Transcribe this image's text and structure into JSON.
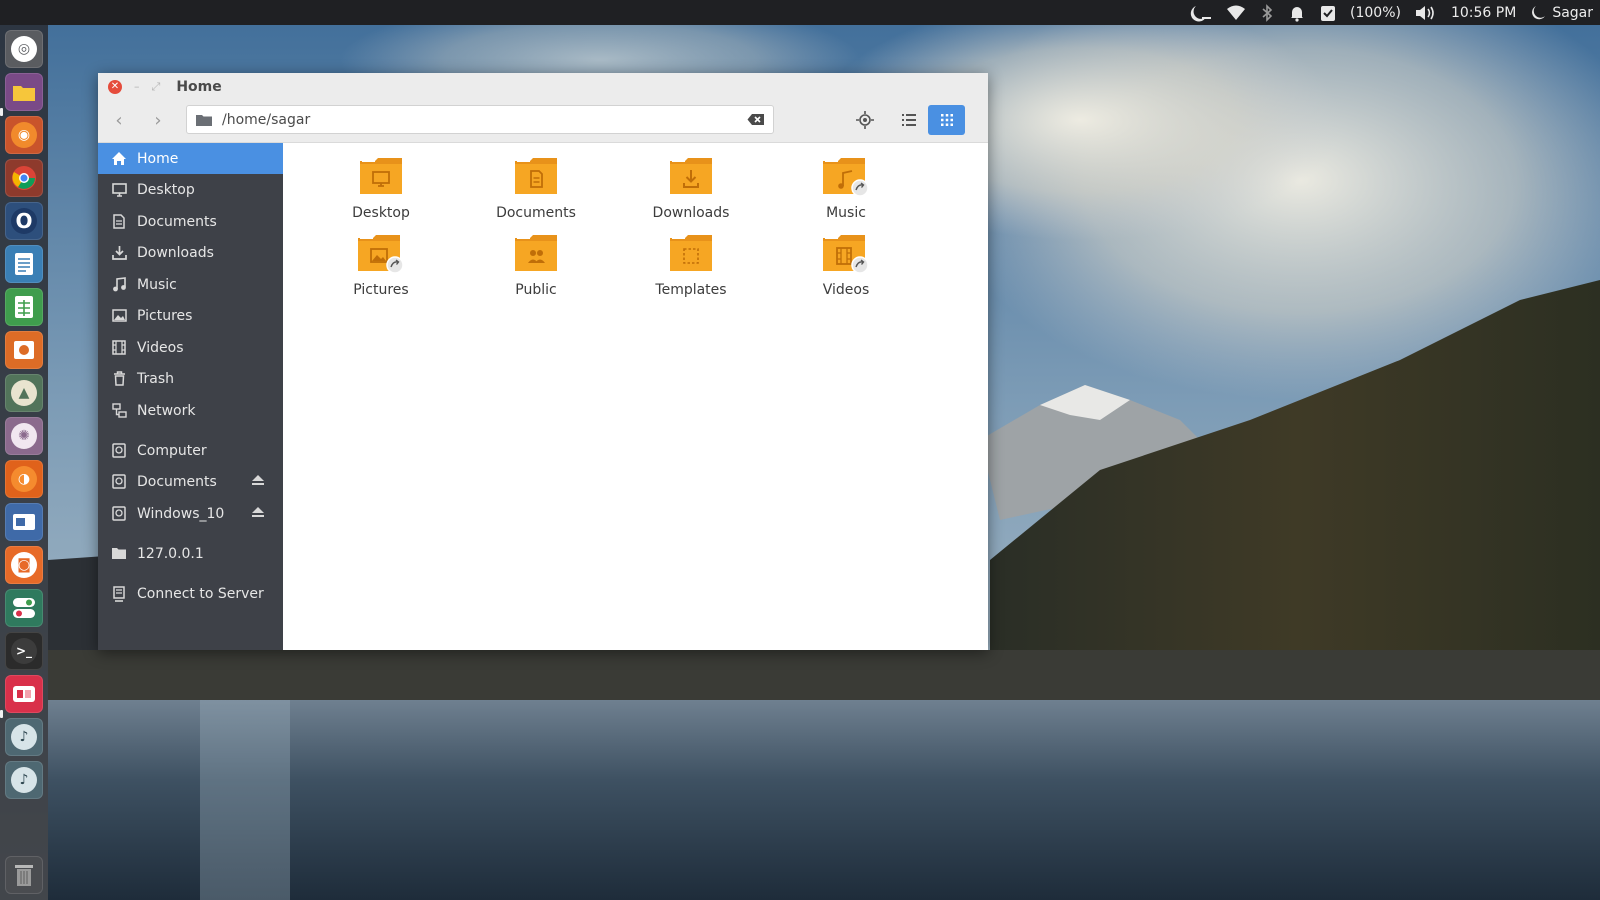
{
  "panel": {
    "battery": "(100%)",
    "clock": "10:56 PM",
    "user": "Sagar",
    "icons": [
      "night-light-icon",
      "wifi-icon",
      "bluetooth-icon",
      "notification-bell-icon",
      "clipboard-check-icon",
      "volume-icon",
      "session-icon"
    ]
  },
  "launcher": {
    "items": [
      {
        "name": "dash",
        "icon": "ubuntu-logo-icon",
        "color": "#5a5c60"
      },
      {
        "name": "files",
        "icon": "folder-icon",
        "color": "#7a4a87"
      },
      {
        "name": "firefox",
        "icon": "firefox-icon",
        "color": "#c9542b"
      },
      {
        "name": "chrome",
        "icon": "chrome-icon",
        "color": "#d14c2c"
      },
      {
        "name": "opera",
        "icon": "opera-icon",
        "color": "#2d4f7c"
      },
      {
        "name": "writer",
        "icon": "text-document-icon",
        "color": "#3a7fb5"
      },
      {
        "name": "calc",
        "icon": "spreadsheet-icon",
        "color": "#3f9d4d"
      },
      {
        "name": "impress",
        "icon": "presentation-icon",
        "color": "#dd6c26"
      },
      {
        "name": "inkscape",
        "icon": "inkscape-icon",
        "color": "#52745a"
      },
      {
        "name": "atom",
        "icon": "atom-icon",
        "color": "#8b6a8d"
      },
      {
        "name": "software-center",
        "icon": "orange-app-icon",
        "color": "#e0621b"
      },
      {
        "name": "virtualbox",
        "icon": "window-app-icon",
        "color": "#3f6aa8"
      },
      {
        "name": "ubuntu-software",
        "icon": "camera-app-icon",
        "color": "#e76a28"
      },
      {
        "name": "settings",
        "icon": "toggle-app-icon",
        "color": "#2f7a5e"
      },
      {
        "name": "terminal",
        "icon": "terminal-icon",
        "color": "#2b2b2b"
      },
      {
        "name": "recorder",
        "icon": "record-app-icon",
        "color": "#d9304a"
      },
      {
        "name": "app-a",
        "icon": "mic-app-icon",
        "color": "#4e6872"
      },
      {
        "name": "app-b",
        "icon": "mic-app-icon",
        "color": "#4e6872"
      }
    ],
    "trash": "trash-icon"
  },
  "window": {
    "title": "Home",
    "location": "/home/sagar",
    "sidebar": [
      {
        "label": "Home",
        "icon": "home-icon",
        "selected": true
      },
      {
        "label": "Desktop",
        "icon": "desktop-icon"
      },
      {
        "label": "Documents",
        "icon": "document-icon"
      },
      {
        "label": "Downloads",
        "icon": "download-icon"
      },
      {
        "label": "Music",
        "icon": "music-icon"
      },
      {
        "label": "Pictures",
        "icon": "picture-icon"
      },
      {
        "label": "Videos",
        "icon": "video-icon"
      },
      {
        "label": "Trash",
        "icon": "trash-icon"
      },
      {
        "label": "Network",
        "icon": "network-icon"
      },
      {
        "label": "Computer",
        "icon": "drive-icon"
      },
      {
        "label": "Documents",
        "icon": "drive-icon",
        "eject": true
      },
      {
        "label": "Windows_10",
        "icon": "drive-icon",
        "eject": true
      },
      {
        "label": "127.0.0.1",
        "icon": "folder-icon"
      },
      {
        "label": "Connect to Server",
        "icon": "server-icon"
      }
    ],
    "folders": [
      {
        "label": "Desktop",
        "icon": "desktop-folder-icon"
      },
      {
        "label": "Documents",
        "icon": "documents-folder-icon"
      },
      {
        "label": "Downloads",
        "icon": "downloads-folder-icon"
      },
      {
        "label": "Music",
        "icon": "music-folder-icon",
        "linked": true
      },
      {
        "label": "Pictures",
        "icon": "pictures-folder-icon",
        "linked": true
      },
      {
        "label": "Public",
        "icon": "public-folder-icon"
      },
      {
        "label": "Templates",
        "icon": "templates-folder-icon"
      },
      {
        "label": "Videos",
        "icon": "videos-folder-icon",
        "linked": true
      }
    ]
  },
  "colors": {
    "accent": "#4a90e2",
    "folder": "#f6a623",
    "sidebar": "#3e4148",
    "panel": "#1f2023"
  }
}
